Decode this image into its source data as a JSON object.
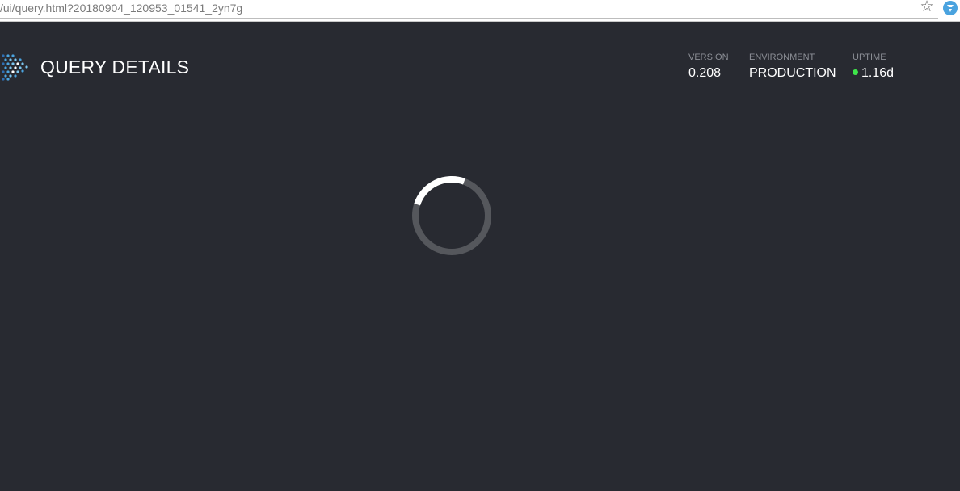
{
  "browser": {
    "url": "/ui/query.html?20180904_120953_01541_2yn7g",
    "bookmark_icon": "star-icon",
    "extension_icon": "extension-icon"
  },
  "header": {
    "logo_icon": "dots-logo-icon",
    "title": "QUERY DETAILS",
    "stats": {
      "version": {
        "label": "VERSION",
        "value": "0.208"
      },
      "environment": {
        "label": "ENVIRONMENT",
        "value": "PRODUCTION"
      },
      "uptime": {
        "label": "UPTIME",
        "value": "1.16d",
        "status_color": "#3ee54a"
      }
    }
  },
  "main": {
    "loading_indicator": "spinner-icon"
  },
  "colors": {
    "background": "#282a31",
    "header_rule": "#3a9fd1",
    "text": "#ffffff",
    "label": "#8c8f96",
    "spinner_track": "#55575c",
    "spinner_arc": "#ffffff"
  }
}
